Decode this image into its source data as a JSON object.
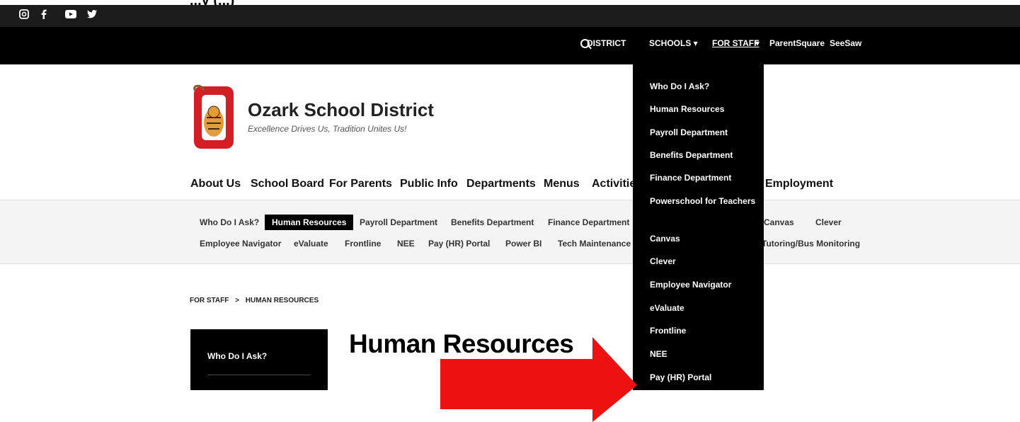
{
  "top_fragment": "...y (...)",
  "social": {
    "items": [
      "instagram-icon",
      "facebook-icon",
      "youtube-icon",
      "twitter-icon"
    ]
  },
  "topnav": {
    "items": [
      {
        "label": "DISTRICT"
      },
      {
        "label": "SCHOOLS ▾"
      },
      {
        "label": "FOR STAFF"
      },
      {
        "caret": "▾"
      },
      {
        "label": "ParentSquare"
      },
      {
        "label": "SeeSaw"
      }
    ]
  },
  "site": {
    "title": "Ozark School District",
    "tagline": "Excellence Drives Us, Tradition Unites Us!"
  },
  "mainnav": {
    "items": [
      "About Us",
      "School Board",
      "For Parents",
      "Public Info",
      "Departments",
      "Menus",
      "Activities",
      "Employment"
    ]
  },
  "subnav": {
    "row1": [
      "Who Do I Ask?",
      "Human Resources",
      "Payroll Department",
      "Benefits Department",
      "Finance Department",
      "Canvas",
      "Clever"
    ],
    "row2": [
      "Employee Navigator",
      "eValuate",
      "Frontline",
      "NEE",
      "Pay (HR) Portal",
      "Power BI",
      "Tech Maintenance V",
      "Tutoring/Bus Monitoring"
    ]
  },
  "breadcrumb": {
    "parent": "FOR STAFF",
    "separator": ">",
    "current": "HUMAN RESOURCES"
  },
  "sidebar": {
    "item": "Who Do I Ask?"
  },
  "page": {
    "heading": "Human Resources"
  },
  "dropdown": {
    "items": [
      "Who Do I Ask?",
      "Human Resources",
      "Payroll Department",
      "Benefits Department",
      "Finance Department",
      "Powerschool for Teachers",
      "Canvas",
      "Clever",
      "Employee Navigator",
      "eValuate",
      "Frontline",
      "NEE",
      "Pay (HR) Portal"
    ]
  },
  "colors": {
    "topbar": "#000000",
    "accent": "#ee1111",
    "logo_red": "#d21f26"
  }
}
